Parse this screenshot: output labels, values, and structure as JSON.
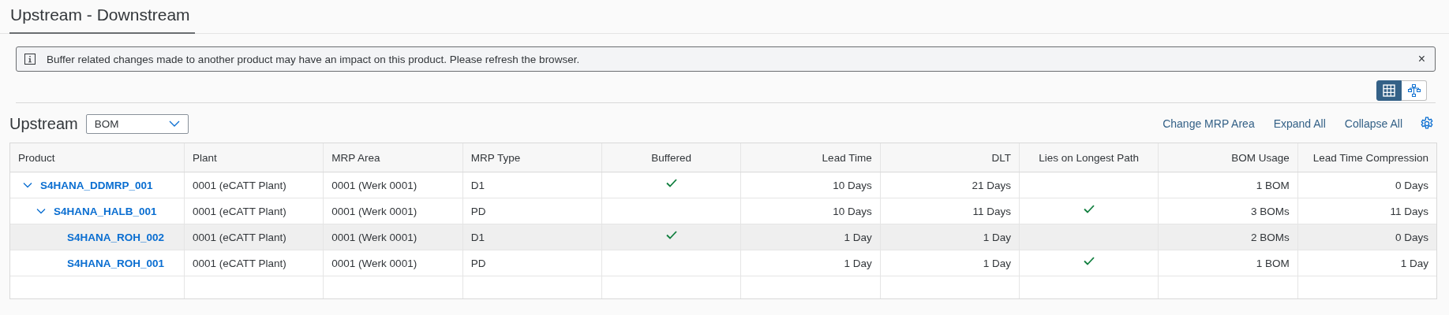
{
  "page_tab": {
    "label": "Upstream - Downstream",
    "selected": true
  },
  "message_strip": {
    "text": "Buffer related changes made to another product may have an impact on this product. Please refresh the browser.",
    "close": "×"
  },
  "view_toggle": [
    {
      "kind": "table",
      "selected": true
    },
    {
      "kind": "network",
      "selected": false
    }
  ],
  "section": {
    "title": "Upstream",
    "select": {
      "value": "BOM"
    },
    "actions": [
      "Change MRP Area",
      "Expand All",
      "Collapse All"
    ]
  },
  "table": {
    "columns": [
      {
        "label": "Product",
        "kind": "link"
      },
      {
        "label": "Plant",
        "kind": "text"
      },
      {
        "label": "MRP Area",
        "kind": "text"
      },
      {
        "label": "MRP Type",
        "kind": "text"
      },
      {
        "label": "Buffered",
        "kind": "check"
      },
      {
        "label": "Lead Time",
        "kind": "number"
      },
      {
        "label": "DLT",
        "kind": "number"
      },
      {
        "label": "Lies on Longest Path",
        "kind": "check"
      },
      {
        "label": "BOM Usage",
        "kind": "number"
      },
      {
        "label": "Lead Time Compression",
        "kind": "number"
      }
    ],
    "rows": [
      {
        "expanded": true,
        "selected": false,
        "cells": [
          "S4HANA_DDMRP_001",
          "0001 (eCATT Plant)",
          "0001 (Werk 0001)",
          "D1",
          true,
          "10 Days",
          "21 Days",
          false,
          "1 BOM",
          "0 Days"
        ],
        "children": [
          {
            "expanded": true,
            "selected": false,
            "cells": [
              "S4HANA_HALB_001",
              "0001 (eCATT Plant)",
              "0001 (Werk 0001)",
              "PD",
              false,
              "10 Days",
              "11 Days",
              true,
              "3 BOMs",
              "11 Days"
            ],
            "children": [
              {
                "selected": true,
                "cells": [
                  "S4HANA_ROH_002",
                  "0001 (eCATT Plant)",
                  "0001 (Werk 0001)",
                  "D1",
                  true,
                  "1 Day",
                  "1 Day",
                  false,
                  "2 BOMs",
                  "0 Days"
                ]
              },
              {
                "selected": false,
                "cells": [
                  "S4HANA_ROH_001",
                  "0001 (eCATT Plant)",
                  "0001 (Werk 0001)",
                  "PD",
                  false,
                  "1 Day",
                  "1 Day",
                  true,
                  "1 BOM",
                  "1 Day"
                ]
              }
            ]
          }
        ]
      }
    ]
  }
}
